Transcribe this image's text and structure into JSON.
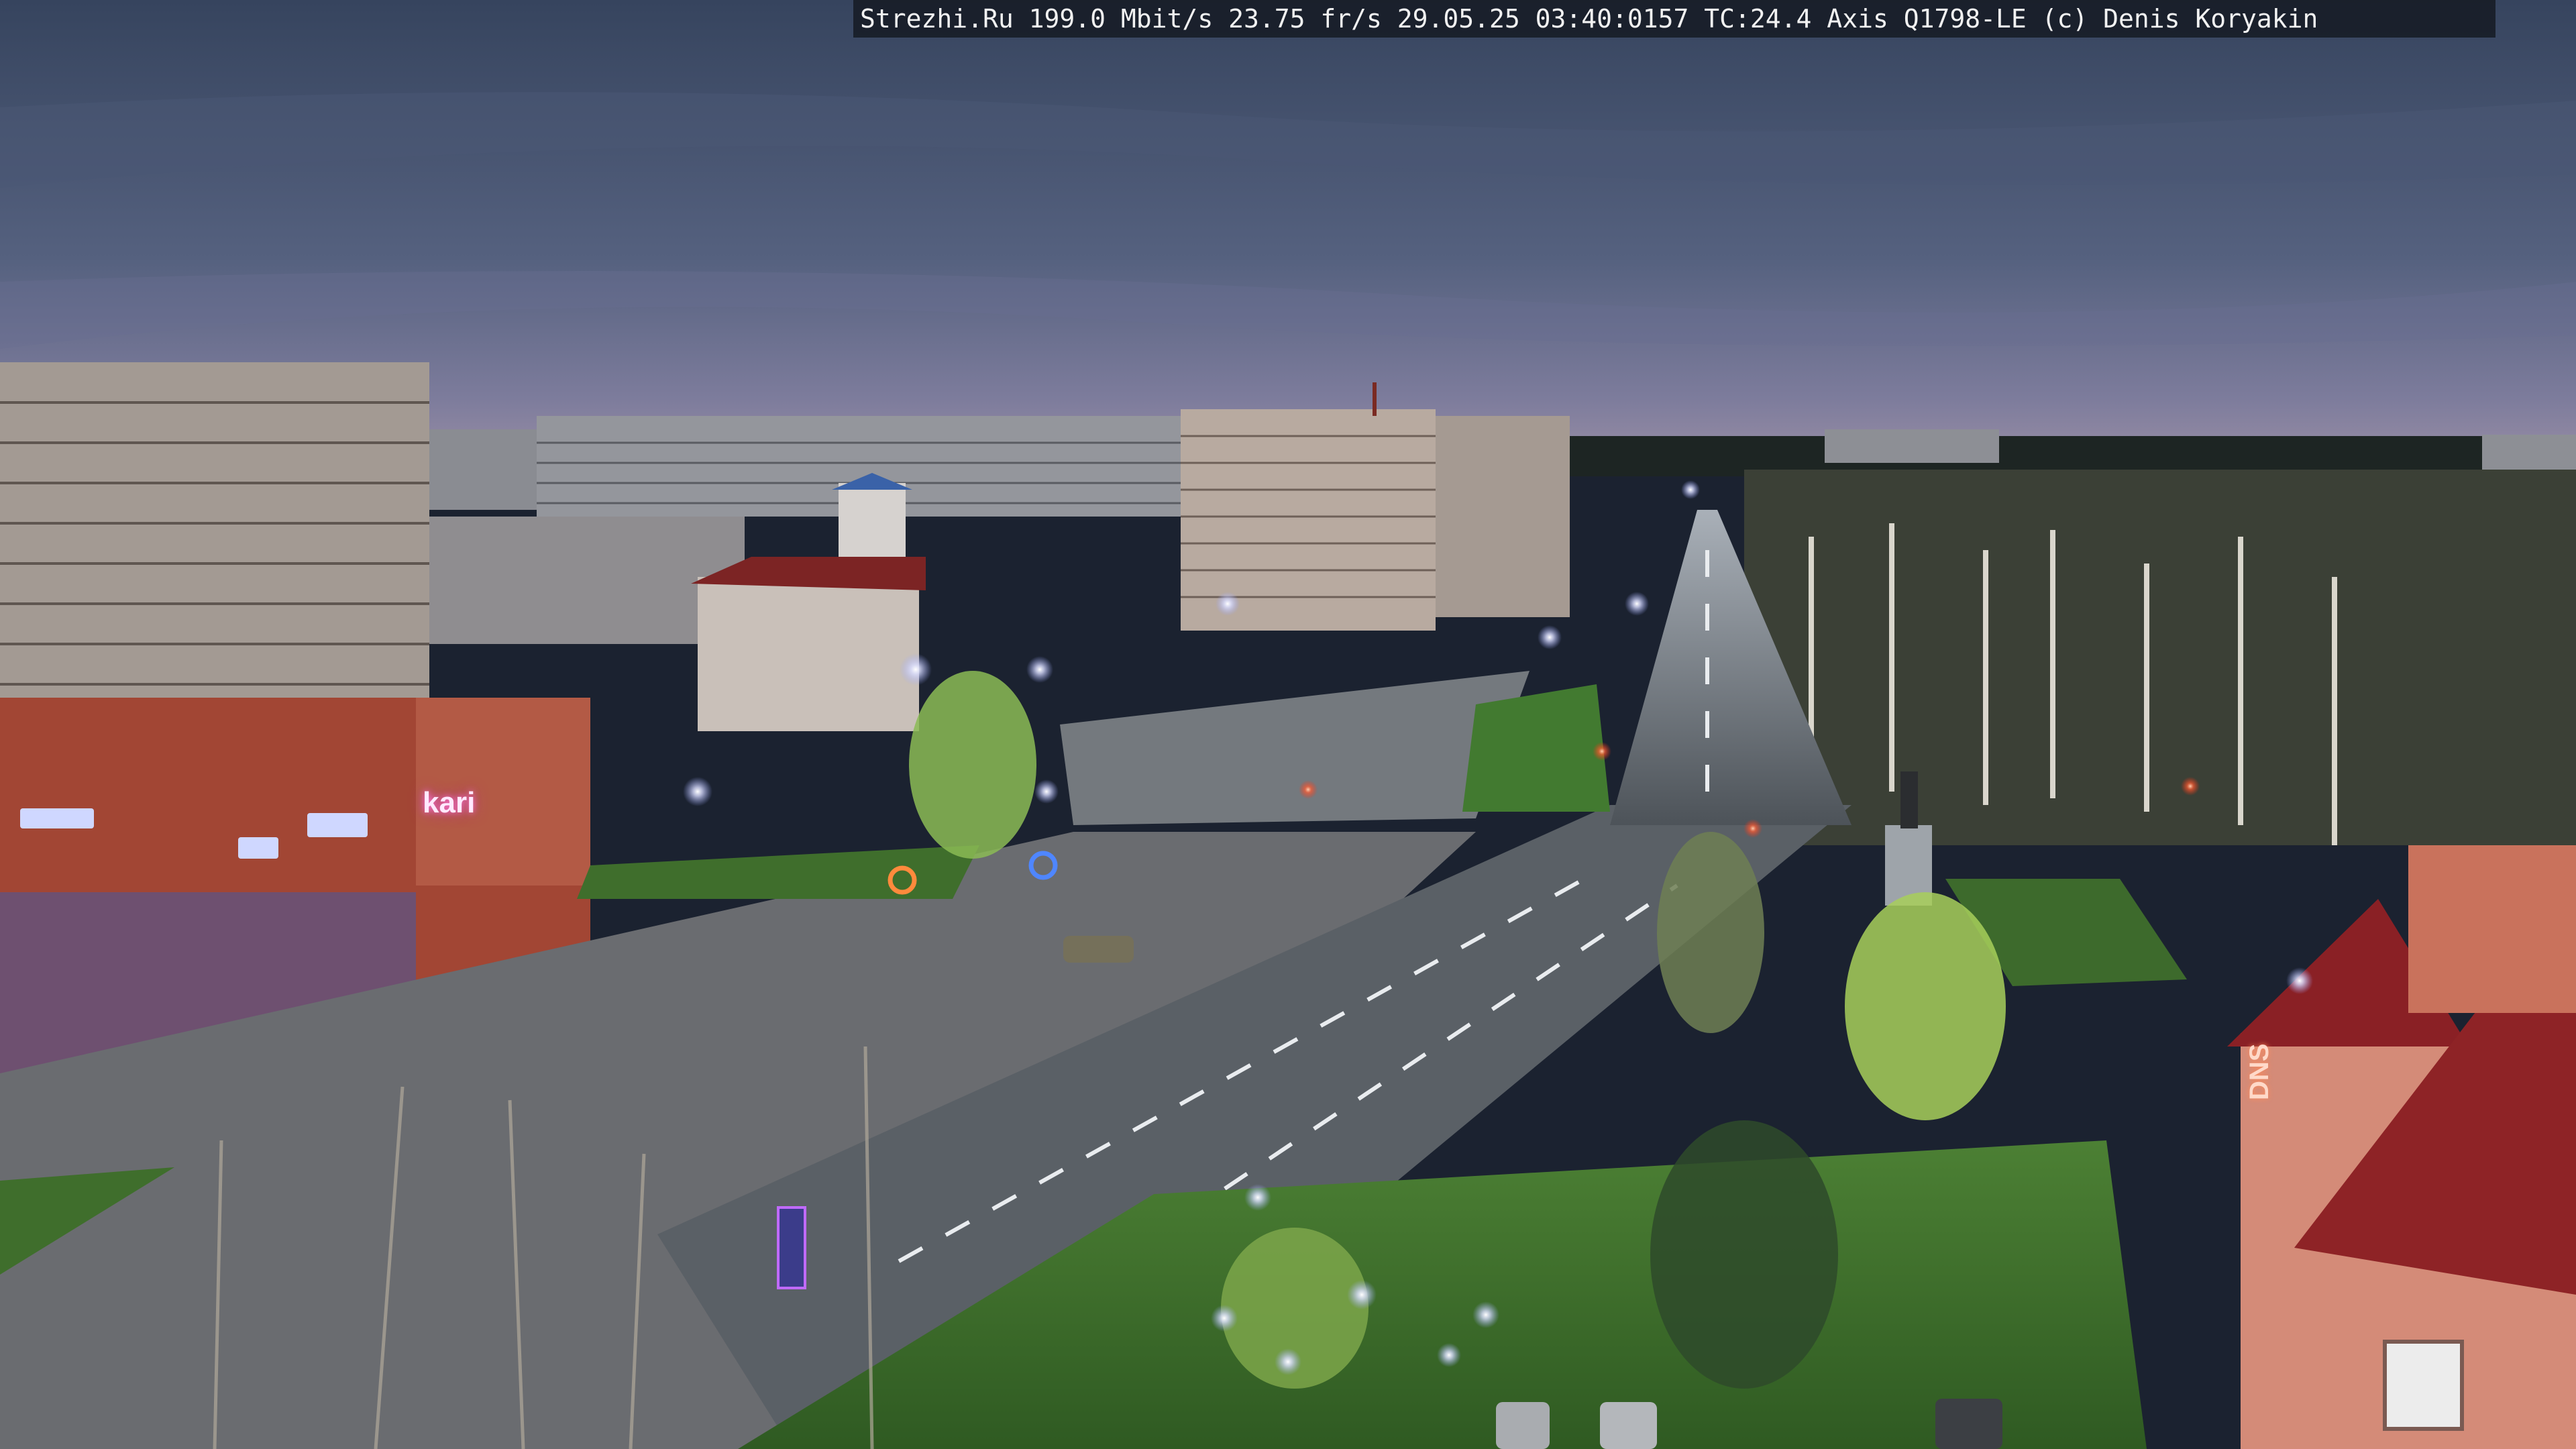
{
  "overlay": {
    "caption": "Strezhi.Ru 199.0 Mbit/s 23.75 fr/s 29.05.25 03:40:0157 TC:24.4  Axis Q1798-LE  (c) Denis Koryakin"
  },
  "signs": {
    "store_left": "kari",
    "store_right": "DNS"
  },
  "colors": {
    "sky_top": "#3f4e6b",
    "sky_horizon": "#8a86a6",
    "lamp_glow": "#cfd6ff",
    "grass": "#3f6e2c",
    "road": "#5d646a",
    "roof_red": "#8e2326"
  }
}
